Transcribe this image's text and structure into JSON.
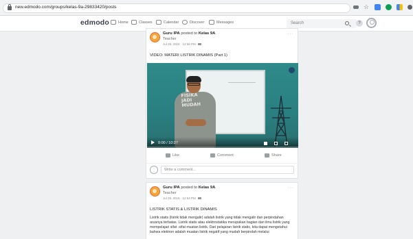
{
  "browser": {
    "url": "new.edmodo.com/groups/kelas-9a-29833420/posts",
    "extension_colors": [
      "#6e7478",
      "#f4c20d",
      "#4285f4",
      "#0f9d58",
      "#4285f4",
      "#5f6368"
    ]
  },
  "header": {
    "logo": "edmodo",
    "nav": [
      {
        "label": "Home",
        "icon": "home-icon"
      },
      {
        "label": "Classes",
        "icon": "classes-icon"
      },
      {
        "label": "Calendar",
        "icon": "calendar-icon"
      },
      {
        "label": "Discover",
        "icon": "discover-icon"
      },
      {
        "label": "Messages",
        "icon": "messages-icon"
      }
    ],
    "search_placeholder": "Search",
    "help_label": "?"
  },
  "posts": [
    {
      "author": "Guru IPA",
      "posted_to_prefix": "posted to",
      "group": "Kelas 9A",
      "role": "Teacher",
      "date": "Jul 29, 2018 · 12:56 PM",
      "text": "VIDEO: MATERI LISTRIK DINAMIS (Part 1)",
      "video": {
        "time": "0:00 / 10:27",
        "progress": 0.0,
        "shirt_text": [
          "FISIKA",
          "JADI",
          "MUDAH"
        ]
      },
      "actions": [
        {
          "label": "Like",
          "icon": "like-icon"
        },
        {
          "label": "Comment",
          "icon": "comment-icon"
        },
        {
          "label": "Share",
          "icon": "share-icon"
        }
      ],
      "comment_placeholder": "Write a comment..."
    },
    {
      "author": "Guru IPA",
      "posted_to_prefix": "posted to",
      "group": "Kelas 9A",
      "role": "Teacher",
      "date": "Jul 29, 2018 · 12:54 PM",
      "text": "LISTRIK STATIS & LISTRIK DINAMIS",
      "body": "Listrik statis (listrik tidak mengalir) adalah listrik yang tidak mengalir dan perpindahan arusnya terbatas. Listrik statis atau elektrostatika merupakan bagian dari ilmu listrik yang mempelajari sifat -sifat muatan listrik. Dari pelajaran listrik statis, kita dapat mengetahui bahwa elektron adalah muatan listrik negatif yang mudah berpindah melalui"
    }
  ]
}
